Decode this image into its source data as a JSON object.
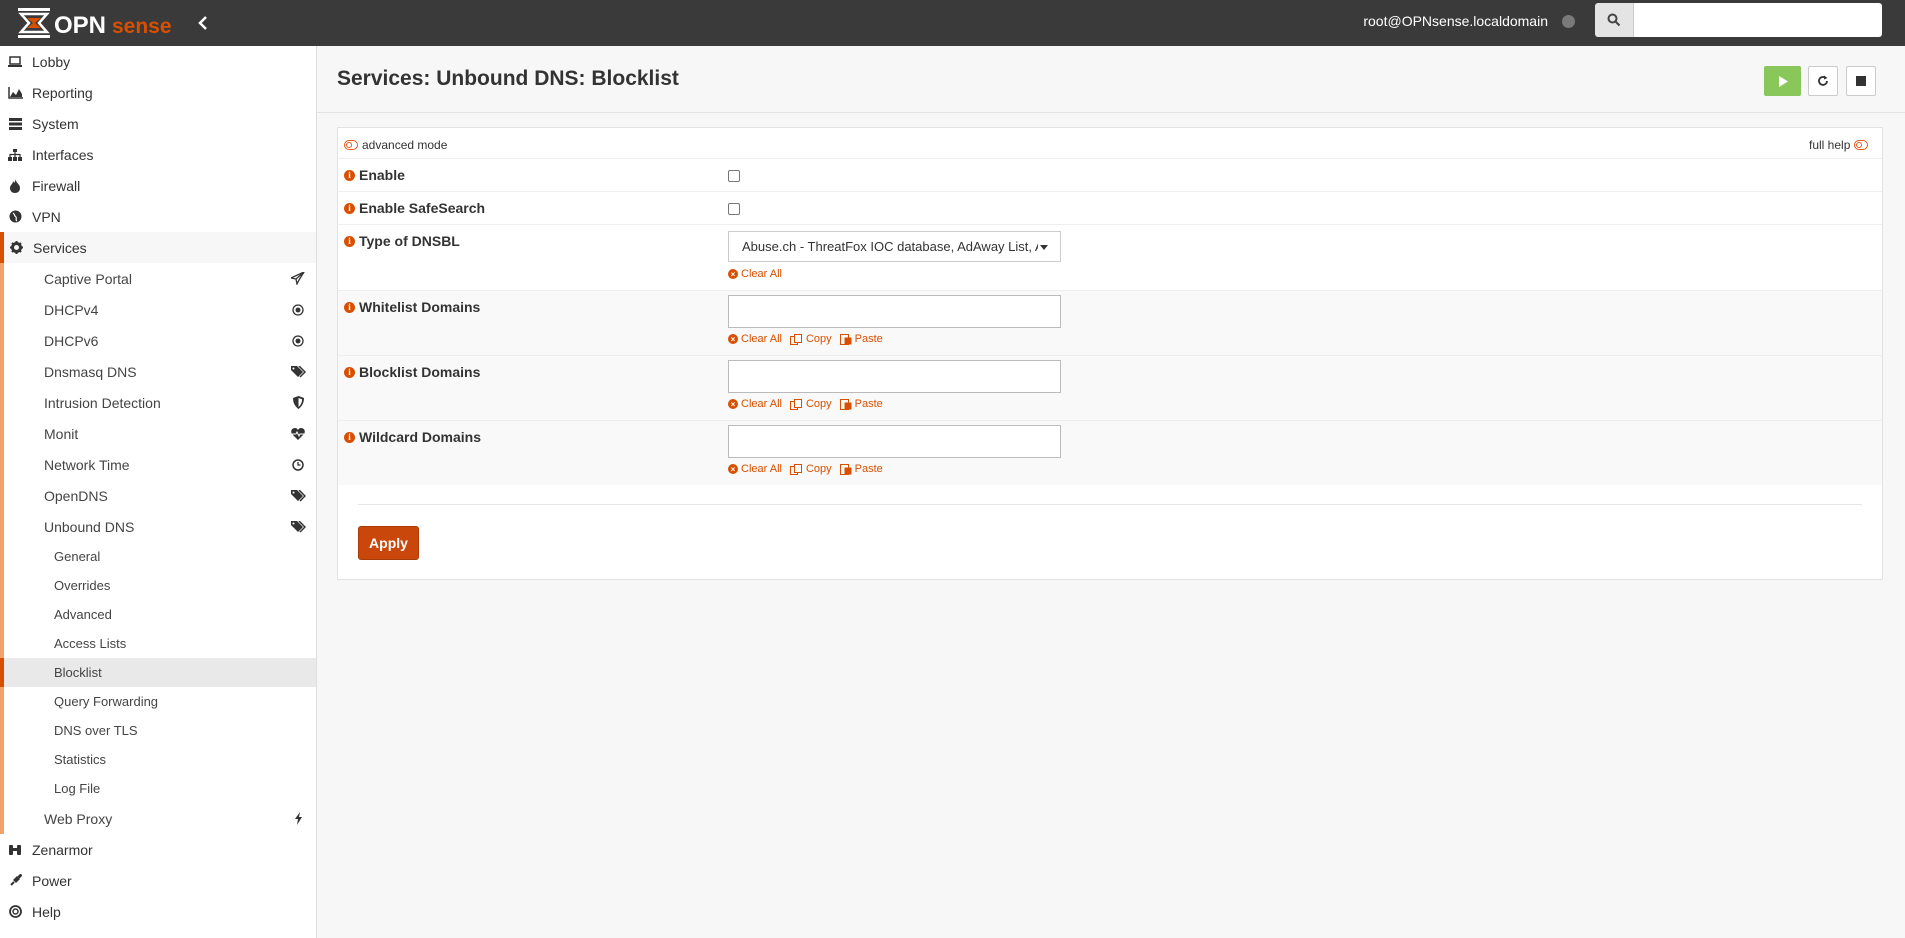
{
  "topbar": {
    "logo_text": "OPNsense",
    "user": "root@OPNsense.localdomain",
    "search_placeholder": ""
  },
  "sidebar": {
    "top_items": [
      {
        "label": "Lobby",
        "icon": "laptop-icon"
      },
      {
        "label": "Reporting",
        "icon": "area-chart-icon"
      },
      {
        "label": "System",
        "icon": "server-icon"
      },
      {
        "label": "Interfaces",
        "icon": "sitemap-icon"
      },
      {
        "label": "Firewall",
        "icon": "fire-icon"
      },
      {
        "label": "VPN",
        "icon": "globe-icon"
      },
      {
        "label": "Services",
        "icon": "cog-icon"
      }
    ],
    "services_items": [
      {
        "label": "Captive Portal",
        "icon": "paper-plane-icon"
      },
      {
        "label": "DHCPv4",
        "icon": "bullseye-icon"
      },
      {
        "label": "DHCPv6",
        "icon": "bullseye-icon"
      },
      {
        "label": "Dnsmasq DNS",
        "icon": "tags-icon"
      },
      {
        "label": "Intrusion Detection",
        "icon": "shield-icon"
      },
      {
        "label": "Monit",
        "icon": "heartbeat-icon"
      },
      {
        "label": "Network Time",
        "icon": "clock-icon"
      },
      {
        "label": "OpenDNS",
        "icon": "tags-icon"
      },
      {
        "label": "Unbound DNS",
        "icon": "tags-icon"
      }
    ],
    "unbound_items": [
      "General",
      "Overrides",
      "Advanced",
      "Access Lists",
      "Blocklist",
      "Query Forwarding",
      "DNS over TLS",
      "Statistics",
      "Log File"
    ],
    "web_proxy": {
      "label": "Web Proxy",
      "icon": "bolt-icon"
    },
    "bottom_items": [
      {
        "label": "Zenarmor",
        "icon": "binoculars-icon"
      },
      {
        "label": "Power",
        "icon": "plug-icon"
      },
      {
        "label": "Help",
        "icon": "life-ring-icon"
      }
    ],
    "active_item": "Blocklist"
  },
  "page": {
    "title": "Services: Unbound DNS: Blocklist"
  },
  "form": {
    "advanced_mode": "advanced mode",
    "full_help": "full help",
    "enable_label": "Enable",
    "safesearch_label": "Enable SafeSearch",
    "dnsbl_label": "Type of DNSBL",
    "dnsbl_value": "Abuse.ch - ThreatFox IOC database, AdAway List, Ac",
    "whitelist_label": "Whitelist Domains",
    "blocklist_label": "Blocklist Domains",
    "wildcard_label": "Wildcard Domains",
    "clear_all": "Clear All",
    "copy": "Copy",
    "paste": "Paste",
    "apply": "Apply"
  },
  "colors": {
    "brand_orange": "#d94f00",
    "topbar": "#3a3a3a",
    "play_green": "#8ac75a"
  }
}
